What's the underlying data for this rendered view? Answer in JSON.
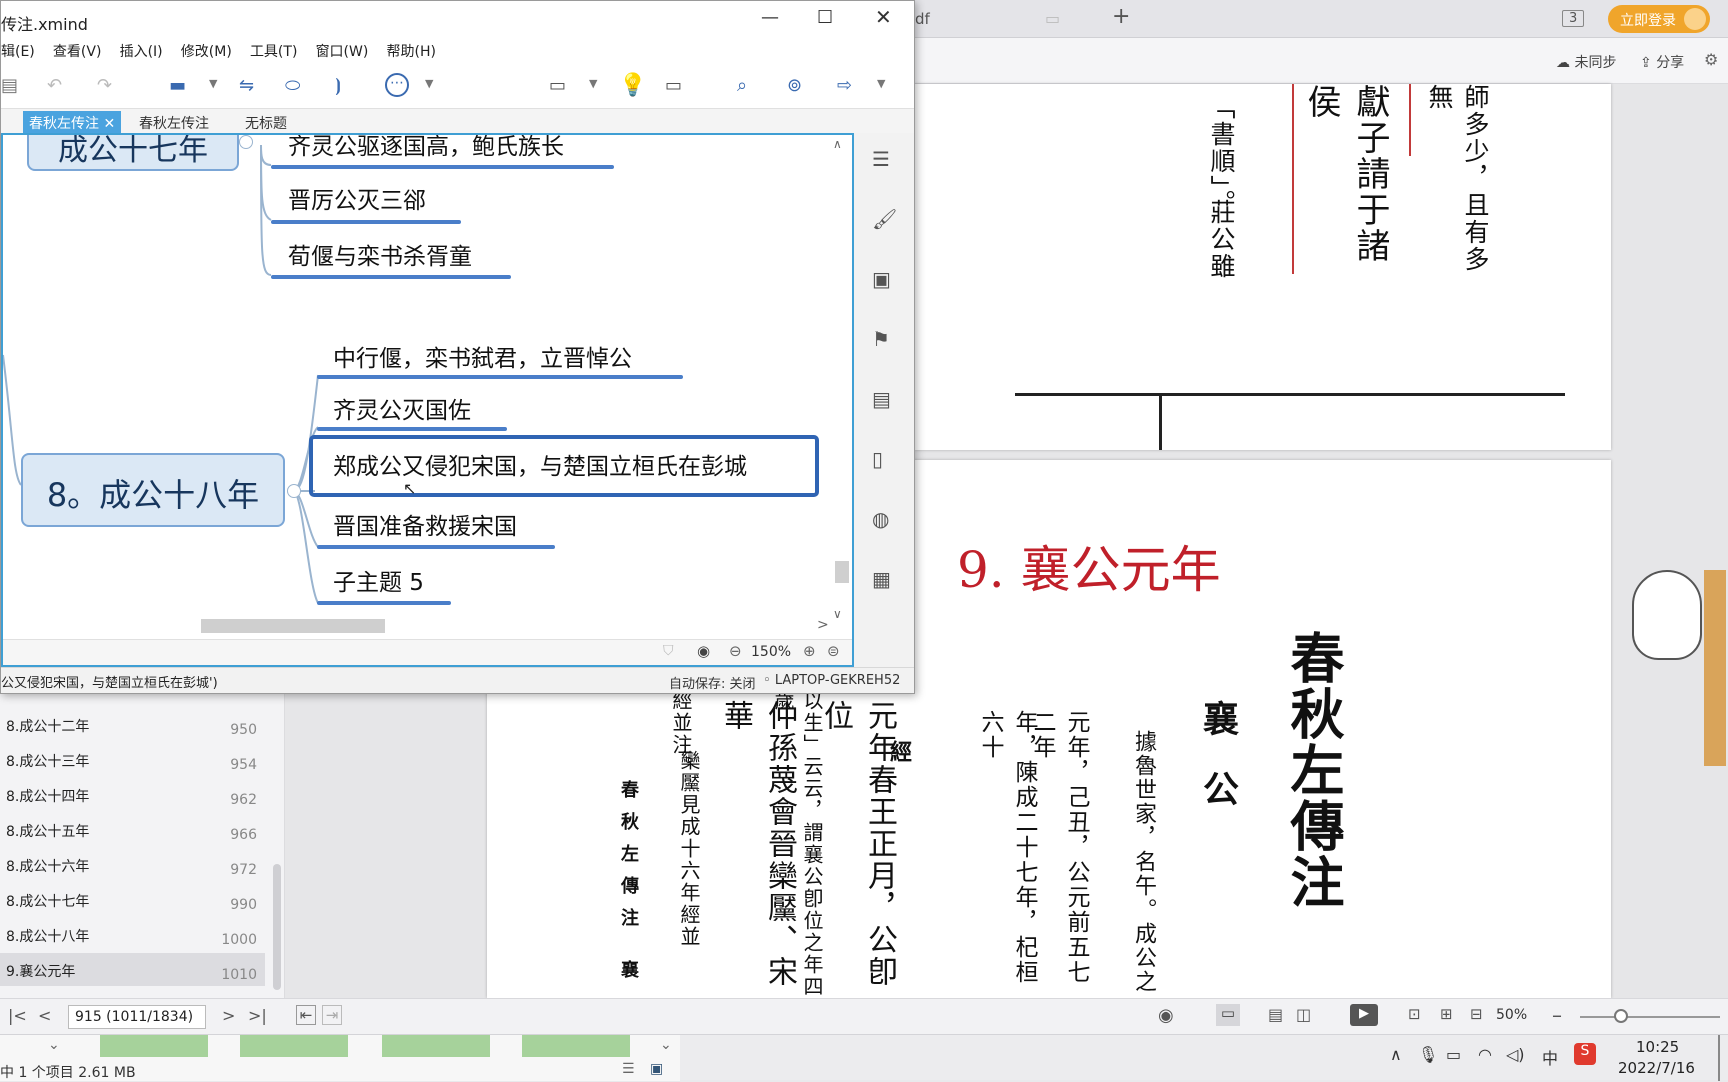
{
  "pdf_viewer": {
    "tab_fragment": "df",
    "page_indicator": "3",
    "login_button": "立即登录",
    "sync_status": "未同步",
    "share_label": "分享",
    "page_top_text": {
      "col1": "「書順」。",
      "col1b": "莊公雖",
      "col2": "獻子請于諸侯",
      "col3": "師多少，且有多無"
    },
    "heading": "9. 襄公元年",
    "page_columns": {
      "title": "春秋左傳注",
      "sub1": "襄",
      "sub2": "公",
      "c1": "據魯世家，名午。成公之",
      "c2": "元年，己丑，公元前五七二年",
      "c3": "年，陳成二十七年，杞桓六十",
      "c4": "經",
      "c5": "元年春王正月，公卽位",
      "c6": "仲孫蔑會晉欒黶、宋華",
      "c7": "欒黶見成十六年經並",
      "c8": "以生」云云，謂襄公卽位之年四歲",
      "c9": "經並注。",
      "side": "春秋左傳注 襄"
    },
    "toc": [
      {
        "label": "8.成公十二年",
        "page": "950"
      },
      {
        "label": "8.成公十三年",
        "page": "954"
      },
      {
        "label": "8.成公十四年",
        "page": "962"
      },
      {
        "label": "8.成公十五年",
        "page": "966"
      },
      {
        "label": "8.成公十六年",
        "page": "972"
      },
      {
        "label": "8.成公十七年",
        "page": "990"
      },
      {
        "label": "8.成公十八年",
        "page": "1000"
      },
      {
        "label": "9.襄公元年",
        "page": "1010"
      }
    ],
    "page_nav": "915 (1011/1834)",
    "zoom": "50%",
    "file_info": "中 1 个项目  2.61 MB"
  },
  "taskbar": {
    "time": "10:25",
    "date": "2022/7/16",
    "ime": "中"
  },
  "xmind": {
    "title": "传注.xmind",
    "menu": [
      "辑(E)",
      "查看(V)",
      "插入(I)",
      "修改(M)",
      "工具(T)",
      "窗口(W)",
      "帮助(H)"
    ],
    "tabs": [
      "春秋左传注",
      "春秋左传注",
      "无标题"
    ],
    "prev_main_topic": "成公十七年",
    "prev_subtopics": [
      "齐灵公驱逐国高，鲍氏族长",
      "晋厉公灭三郤",
      "荀偃与栾书杀胥童"
    ],
    "main_topic": "8。成公十八年",
    "subtopics": [
      "中行偃，栾书弑君，立晋悼公",
      "齐灵公灭国佐",
      "郑成公又侵犯宋国，与楚国立桓氏在彭城",
      "晋国准备救援宋国",
      "子主题 5"
    ],
    "zoom": "150%",
    "status_text": "公又侵犯宋国，与楚国立桓氏在彭城')",
    "autosave": "自动保存: 关闭",
    "computer": "LAPTOP-GEKREH52"
  }
}
